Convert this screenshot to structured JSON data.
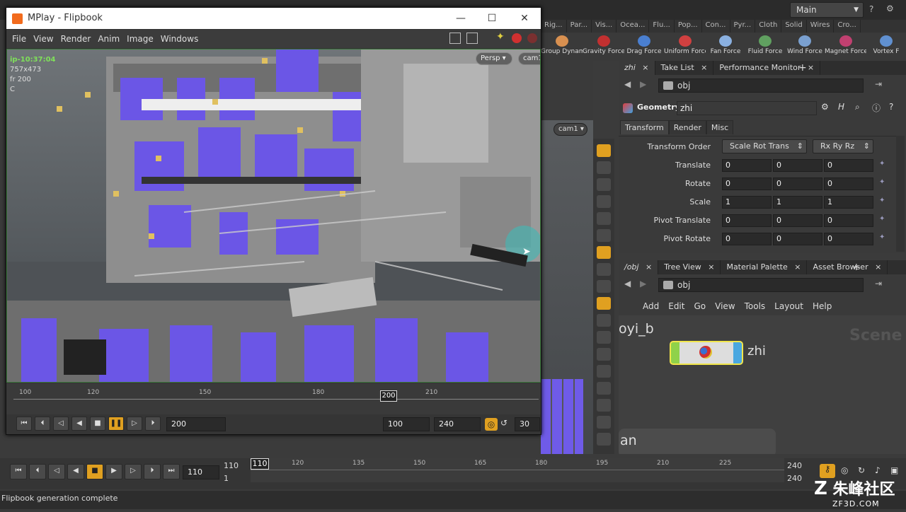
{
  "desktop": {
    "selector": "Main"
  },
  "shelf": {
    "tabs": [
      "Rig...",
      "Par...",
      "Vis...",
      "Ocea...",
      "Flu...",
      "Pop...",
      "Con...",
      "Pyr...",
      "Cloth",
      "Solid",
      "Wires",
      "Cro..."
    ],
    "tools": [
      {
        "label": "Group Dynamic Ob...",
        "color": "#d89050"
      },
      {
        "label": "Gravity Force",
        "color": "#c23030"
      },
      {
        "label": "Drag Force",
        "color": "#4a7fd0"
      },
      {
        "label": "Uniform Force",
        "color": "#d04040"
      },
      {
        "label": "Fan Force",
        "color": "#8ab0e0"
      },
      {
        "label": "Fluid Force",
        "color": "#60a060"
      },
      {
        "label": "Wind Force",
        "color": "#7aa0d0"
      },
      {
        "label": "Magnet Force",
        "color": "#c04070"
      },
      {
        "label": "Vortex F",
        "color": "#6090d0"
      }
    ]
  },
  "params_pane": {
    "tabs": [
      "zhi",
      "Take List",
      "Performance Monitor"
    ],
    "path": "obj",
    "node_type": "Geometry",
    "node_name": "zhi",
    "subtabs": [
      "Transform",
      "Render",
      "Misc"
    ],
    "transform_order_label": "Transform Order",
    "transform_order": "Scale Rot Trans",
    "rotate_order": "Rx Ry Rz",
    "rows": [
      {
        "label": "Translate",
        "v": [
          "0",
          "0",
          "0"
        ]
      },
      {
        "label": "Rotate",
        "v": [
          "0",
          "0",
          "0"
        ]
      },
      {
        "label": "Scale",
        "v": [
          "1",
          "1",
          "1"
        ]
      },
      {
        "label": "Pivot Translate",
        "v": [
          "0",
          "0",
          "0"
        ]
      },
      {
        "label": "Pivot Rotate",
        "v": [
          "0",
          "0",
          "0"
        ]
      }
    ]
  },
  "network_pane": {
    "tabs": [
      "/obj",
      "Tree View",
      "Material Palette",
      "Asset Browser"
    ],
    "path": "obj",
    "menu": [
      "Add",
      "Edit",
      "Go",
      "View",
      "Tools",
      "Layout",
      "Help"
    ],
    "node_left": "oyi_b",
    "node_name": "zhi",
    "watermark_word": "Scene",
    "node_bottom": "an"
  },
  "viewport_bg": {
    "cam": "cam1"
  },
  "flipbook": {
    "title": "MPlay - Flipbook",
    "menu": [
      "File",
      "View",
      "Render",
      "Anim",
      "Image",
      "Windows"
    ],
    "overlay": {
      "ip": "ip-10:37:04",
      "res": "757x473",
      "fr": "fr 200",
      "c": "C"
    },
    "persp": "Persp",
    "cam": "cam1",
    "ticks": [
      "100",
      "120",
      "150",
      "180",
      "210"
    ],
    "current": "200",
    "frame_field": "200",
    "start": "100",
    "end": "240",
    "fps": "30"
  },
  "main_timeline": {
    "frame": "110",
    "start_top": "110",
    "start_bottom": "1",
    "current": "110",
    "ticks": [
      "120",
      "135",
      "150",
      "165",
      "180",
      "195",
      "210",
      "225"
    ],
    "end_top": "240",
    "end_bottom": "240"
  },
  "status": "Flipbook generation complete",
  "watermark": {
    "brand": "朱峰社区",
    "url": "ZF3D.COM"
  }
}
